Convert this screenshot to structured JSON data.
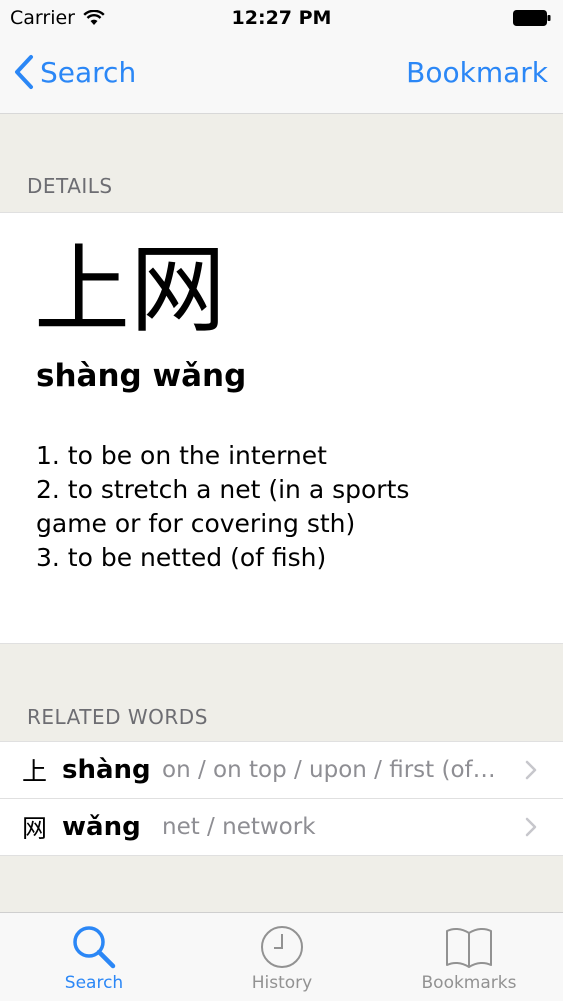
{
  "status_bar": {
    "carrier": "Carrier",
    "time": "12:27 PM"
  },
  "nav": {
    "back_label": "Search",
    "right_label": "Bookmark",
    "accent_color": "#2b87f6"
  },
  "details": {
    "section_title": "DETAILS",
    "hanzi": "上网",
    "pinyin": "shàng wǎng",
    "definitions": [
      "1. to be on the internet",
      "2.  to stretch a net (in a sports game or for covering sth)",
      "3.  to be netted (of fish)"
    ]
  },
  "related": {
    "section_title": "RELATED WORDS",
    "items": [
      {
        "char": "上",
        "pinyin": "shàng",
        "definition": "on / on top / upon / first (of t..."
      },
      {
        "char": "网",
        "pinyin": "wǎng",
        "definition": "net / network"
      }
    ]
  },
  "tabs": [
    {
      "label": "Search",
      "icon": "search-icon",
      "active": true
    },
    {
      "label": "History",
      "icon": "clock-icon",
      "active": false
    },
    {
      "label": "Bookmarks",
      "icon": "book-icon",
      "active": false
    }
  ],
  "colors": {
    "active_tab": "#2b87f6",
    "inactive_tab": "#929292"
  }
}
